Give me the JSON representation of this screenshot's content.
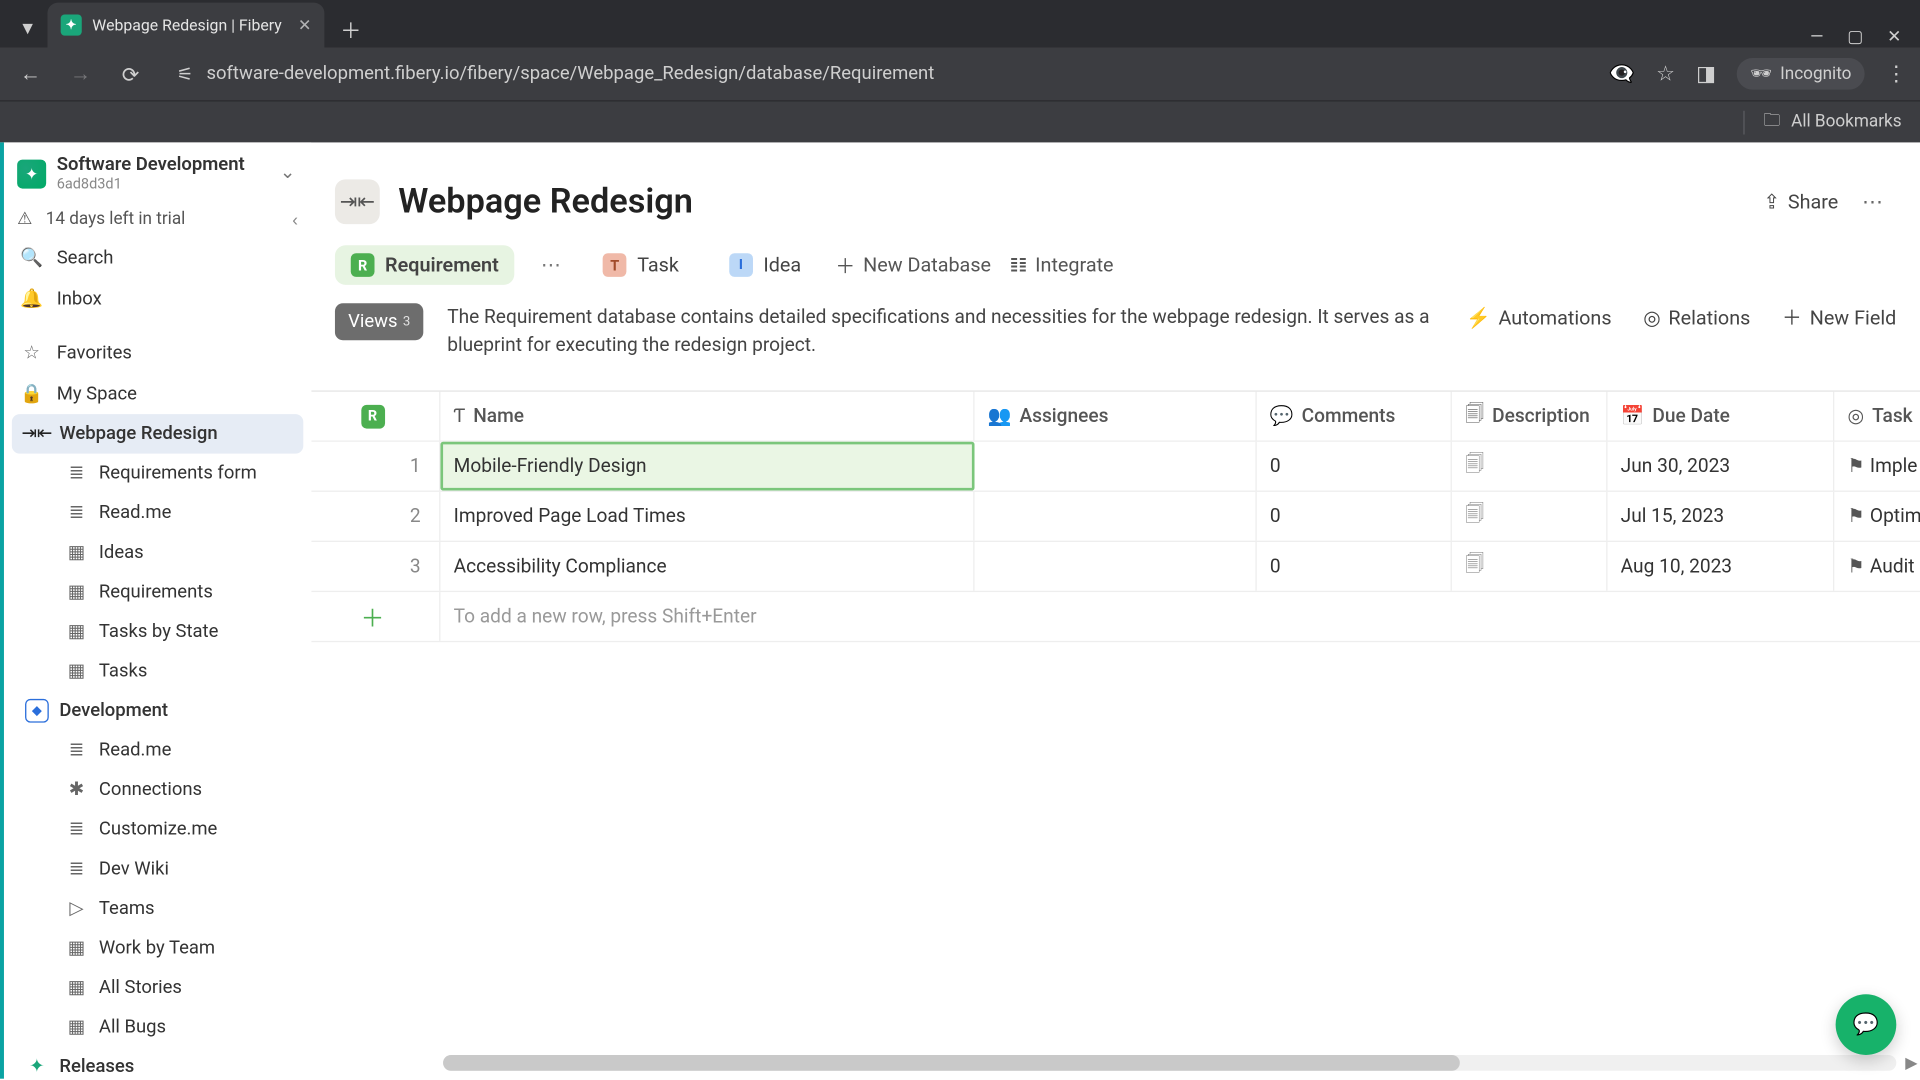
{
  "browser": {
    "tab_title": "Webpage Redesign | Fibery",
    "url": "software-development.fibery.io/fibery/space/Webpage_Redesign/database/Requirement",
    "incognito_label": "Incognito",
    "all_bookmarks": "All Bookmarks"
  },
  "workspace": {
    "name": "Software Development",
    "id": "6ad8d3d1",
    "trial": "14 days left in trial"
  },
  "sidebar": {
    "search": "Search",
    "inbox": "Inbox",
    "favorites": "Favorites",
    "myspace": "My Space",
    "spaces": [
      {
        "name": "Webpage Redesign",
        "active": true,
        "icon": "web",
        "items": [
          {
            "label": "Requirements form",
            "icon": "≣"
          },
          {
            "label": "Read.me",
            "icon": "≣"
          },
          {
            "label": "Ideas",
            "icon": "▦"
          },
          {
            "label": "Requirements",
            "icon": "▦"
          },
          {
            "label": "Tasks by State",
            "icon": "▦"
          },
          {
            "label": "Tasks",
            "icon": "▦"
          }
        ]
      },
      {
        "name": "Development",
        "icon": "dev",
        "items": [
          {
            "label": "Read.me",
            "icon": "≣"
          },
          {
            "label": "Connections",
            "icon": "✱"
          },
          {
            "label": "Customize.me",
            "icon": "≣"
          },
          {
            "label": "Dev Wiki",
            "icon": "≣"
          },
          {
            "label": "Teams",
            "icon": "▷"
          },
          {
            "label": "Work by Team",
            "icon": "▦"
          },
          {
            "label": "All Stories",
            "icon": "▦"
          },
          {
            "label": "All Bugs",
            "icon": "▦"
          }
        ]
      },
      {
        "name": "Releases",
        "icon": "rel",
        "items": []
      }
    ]
  },
  "page": {
    "title": "Webpage Redesign",
    "share": "Share",
    "tabs": {
      "requirement": "Requirement",
      "task": "Task",
      "idea": "Idea",
      "new_database": "New Database",
      "integrate": "Integrate"
    },
    "views_label": "Views",
    "views_count": "3",
    "description": "The Requirement database contains detailed specifications and necessities for the webpage redesign. It serves as a blueprint for executing the redesign project.",
    "actions": {
      "automations": "Automations",
      "relations": "Relations",
      "new_field": "New Field"
    }
  },
  "table": {
    "columns": {
      "name": "Name",
      "assignees": "Assignees",
      "comments": "Comments",
      "description": "Description",
      "due": "Due Date",
      "task": "Task"
    },
    "rows": [
      {
        "n": "1",
        "name": "Mobile-Friendly Design",
        "comments": "0",
        "due": "Jun 30, 2023",
        "task": "Imple"
      },
      {
        "n": "2",
        "name": "Improved Page Load Times",
        "comments": "0",
        "due": "Jul 15, 2023",
        "task": "Optim"
      },
      {
        "n": "3",
        "name": "Accessibility Compliance",
        "comments": "0",
        "due": "Aug 10, 2023",
        "task": "Audit"
      }
    ],
    "add_row_hint": "To add a new row, press Shift+Enter"
  }
}
